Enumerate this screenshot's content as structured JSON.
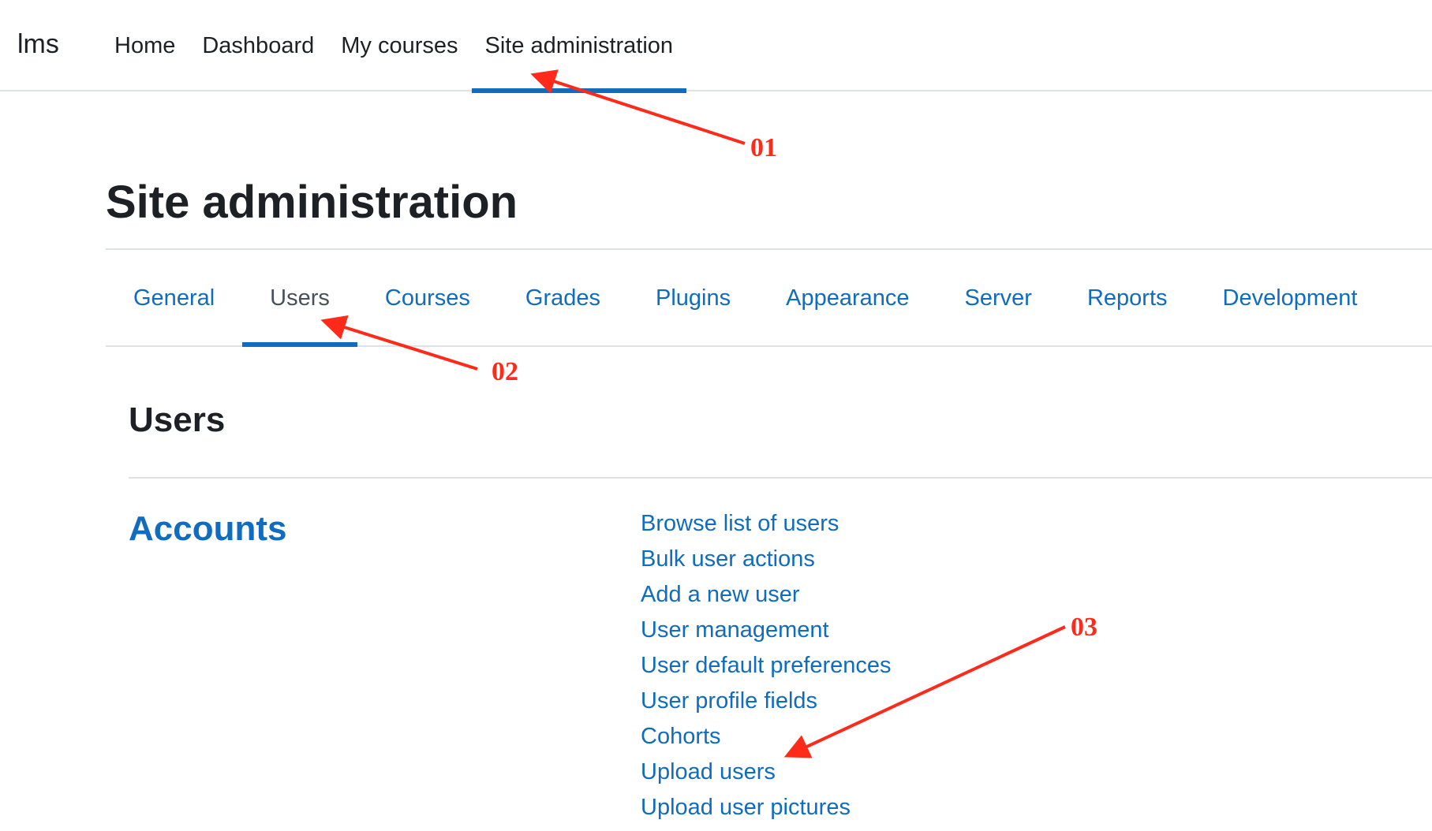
{
  "navbar": {
    "brand": "lms",
    "items": [
      {
        "label": "Home",
        "active": false
      },
      {
        "label": "Dashboard",
        "active": false
      },
      {
        "label": "My courses",
        "active": false
      },
      {
        "label": "Site administration",
        "active": true
      }
    ]
  },
  "page": {
    "title": "Site administration"
  },
  "tabs": [
    {
      "label": "General",
      "active": false
    },
    {
      "label": "Users",
      "active": true
    },
    {
      "label": "Courses",
      "active": false
    },
    {
      "label": "Grades",
      "active": false
    },
    {
      "label": "Plugins",
      "active": false
    },
    {
      "label": "Appearance",
      "active": false
    },
    {
      "label": "Server",
      "active": false
    },
    {
      "label": "Reports",
      "active": false
    },
    {
      "label": "Development",
      "active": false
    }
  ],
  "section": {
    "title": "Users",
    "category": {
      "title": "Accounts",
      "links": [
        "Browse list of users",
        "Bulk user actions",
        "Add a new user",
        "User management",
        "User default preferences",
        "User profile fields",
        "Cohorts",
        "Upload users",
        "Upload user pictures"
      ]
    }
  },
  "annotations": {
    "color": "#ff2a1a",
    "labels": [
      "01",
      "02",
      "03"
    ]
  },
  "colors": {
    "link": "#0f6cbf",
    "text": "#1d2125",
    "active_indicator": "#0f6cbf",
    "divider": "#dee2e6"
  }
}
